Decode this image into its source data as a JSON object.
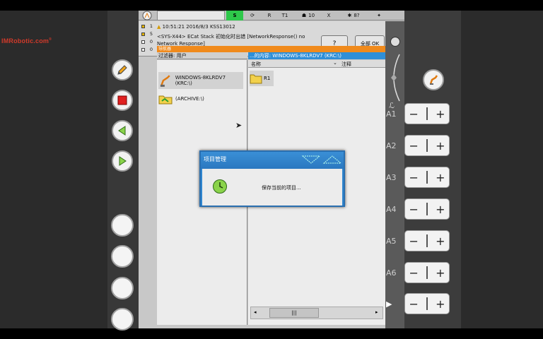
{
  "logo": {
    "text": "IMRobotic.com",
    "reg": "®"
  },
  "topbar": {
    "s_label": "S",
    "r_label": "R",
    "t_label": "T1",
    "override": "10",
    "x_label": "X",
    "ratio_label": "8?",
    "tool_label": "10"
  },
  "messages": {
    "counts": [
      "1",
      "5",
      "0",
      "0"
    ],
    "time_line": "10:51:21 2016/8/3 KSS13012",
    "text_line1": "<SYS-X44> ECat Stack 初始化时出错 [NetworkResponse() no",
    "text_line2": "Network Response]",
    "help_label": "?",
    "ok_label": "全部 OK"
  },
  "navigator": {
    "strip_label": "导航器",
    "filter_label": "过滤器: 用户",
    "content_label": "...的内容: WINDOWS-8KLRDV7 (KRC:\\)",
    "tree": [
      {
        "label": "WINDOWS-8KLRDV7 (KRC:\\)"
      },
      {
        "label": "(ARCHIVE:\\)"
      }
    ],
    "columns": [
      "名称",
      "注释"
    ],
    "files": [
      {
        "name": "R1"
      }
    ],
    "scroll_label": "|||"
  },
  "dialog": {
    "title": "项目管理",
    "message": "保存当前的项目..."
  },
  "axes": [
    "A1",
    "A2",
    "A3",
    "A4",
    "A5",
    "A6",
    ""
  ],
  "colors": {
    "accent": "#2f86cf",
    "nav_orange": "#f08a1c",
    "status_green": "#2ec84a"
  }
}
